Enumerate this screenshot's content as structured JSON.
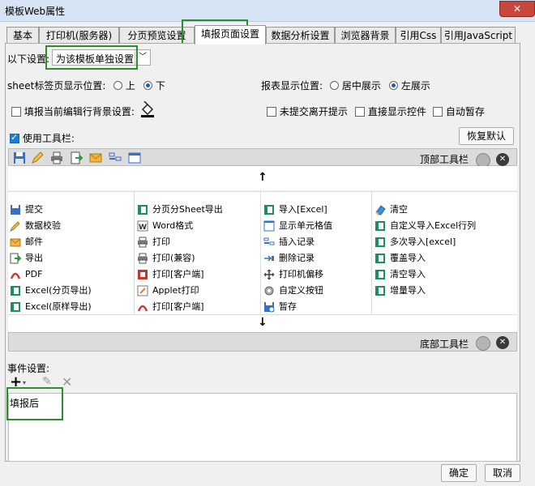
{
  "window": {
    "title": "模板Web属性",
    "close": "✕"
  },
  "tabs": [
    {
      "label": "基本"
    },
    {
      "label": "打印机(服务器)"
    },
    {
      "label": "分页预览设置"
    },
    {
      "label": "填报页面设置",
      "active": true
    },
    {
      "label": "数据分析设置"
    },
    {
      "label": "浏览器背景"
    },
    {
      "label": "引用Css"
    },
    {
      "label": "引用JavaScript"
    }
  ],
  "settings": {
    "label": "以下设置:",
    "value": "为该模板单独设置"
  },
  "sheet_tab": {
    "label": "sheet标签页显示位置:",
    "options": [
      "上",
      "下"
    ],
    "selected": "下"
  },
  "report_pos": {
    "label": "报表显示位置:",
    "options": [
      "居中展示",
      "左展示"
    ],
    "selected": "左展示"
  },
  "checks": {
    "bg": "填报当前编辑行背景设置:",
    "leave": "未提交离开提示",
    "direct": "直接显示控件",
    "autosave": "自动暂存",
    "use_toolbar": "使用工具栏:"
  },
  "restore_button": "恢复默认",
  "top_toolbar_label": "顶部工具栏",
  "bottom_toolbar_label": "底部工具栏",
  "arrow_up": "↑",
  "arrow_down": "↓",
  "items": [
    [
      "提交",
      "数据校验",
      "邮件",
      "导出",
      "PDF",
      "Excel(分页导出)",
      "Excel(原样导出)"
    ],
    [
      "分页分Sheet导出",
      "Word格式",
      "打印",
      "打印(兼容)",
      "打印[客户端]",
      "Applet打印",
      "打印[客户端]"
    ],
    [
      "导入[Excel]",
      "显示单元格值",
      "插入记录",
      "删除记录",
      "打印机偏移",
      "自定义按钮",
      "暂存"
    ],
    [
      "清空",
      "自定义导入Excel行列",
      "多次导入[excel]",
      "覆盖导入",
      "清空导入",
      "增量导入"
    ]
  ],
  "events": {
    "label": "事件设置:",
    "item": "填报后"
  },
  "buttons": {
    "ok": "确定",
    "cancel": "取消"
  }
}
